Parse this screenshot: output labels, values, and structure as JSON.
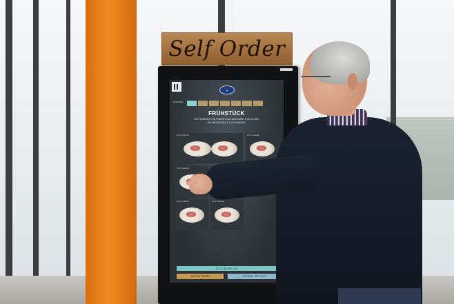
{
  "sign": {
    "text": "Self Order"
  },
  "kiosk": {
    "title": "FRÜHSTÜCK",
    "subtitle": "BITTE WÄHLE EIN FRÜHSTÜCK AUS ODER STELLE DIR EIN INDIVIDUELLES ZUSAMMEN.",
    "qr_caption": "SCANNEN",
    "tabs": [
      "",
      "",
      "",
      "",
      "",
      "",
      ""
    ],
    "cards": [
      {
        "label": "DAS KLEINE",
        "price": ""
      },
      {
        "label": "DAS KLEINE",
        "price": ""
      },
      {
        "label": "DAS KLEINE",
        "price": ""
      },
      {
        "label": "DAS KLEINE",
        "price": ""
      },
      {
        "label": "DAS KLEINE",
        "price": ""
      },
      {
        "label": "DAS KLEINE",
        "price": ""
      },
      {
        "label": "DAS KLEINE",
        "price": ""
      }
    ],
    "cta": "JETZT BESTELLEN",
    "footer_left": "EINKAUFSKORB",
    "footer_right": "2 ARTIKEL FÜR 5,40 €"
  },
  "colors": {
    "pillar": "#ef8a20",
    "kiosk_frame": "#111214",
    "screen_bg": "#2b3237",
    "accent_teal": "#7cc6c7",
    "accent_gold": "#c79a54"
  }
}
